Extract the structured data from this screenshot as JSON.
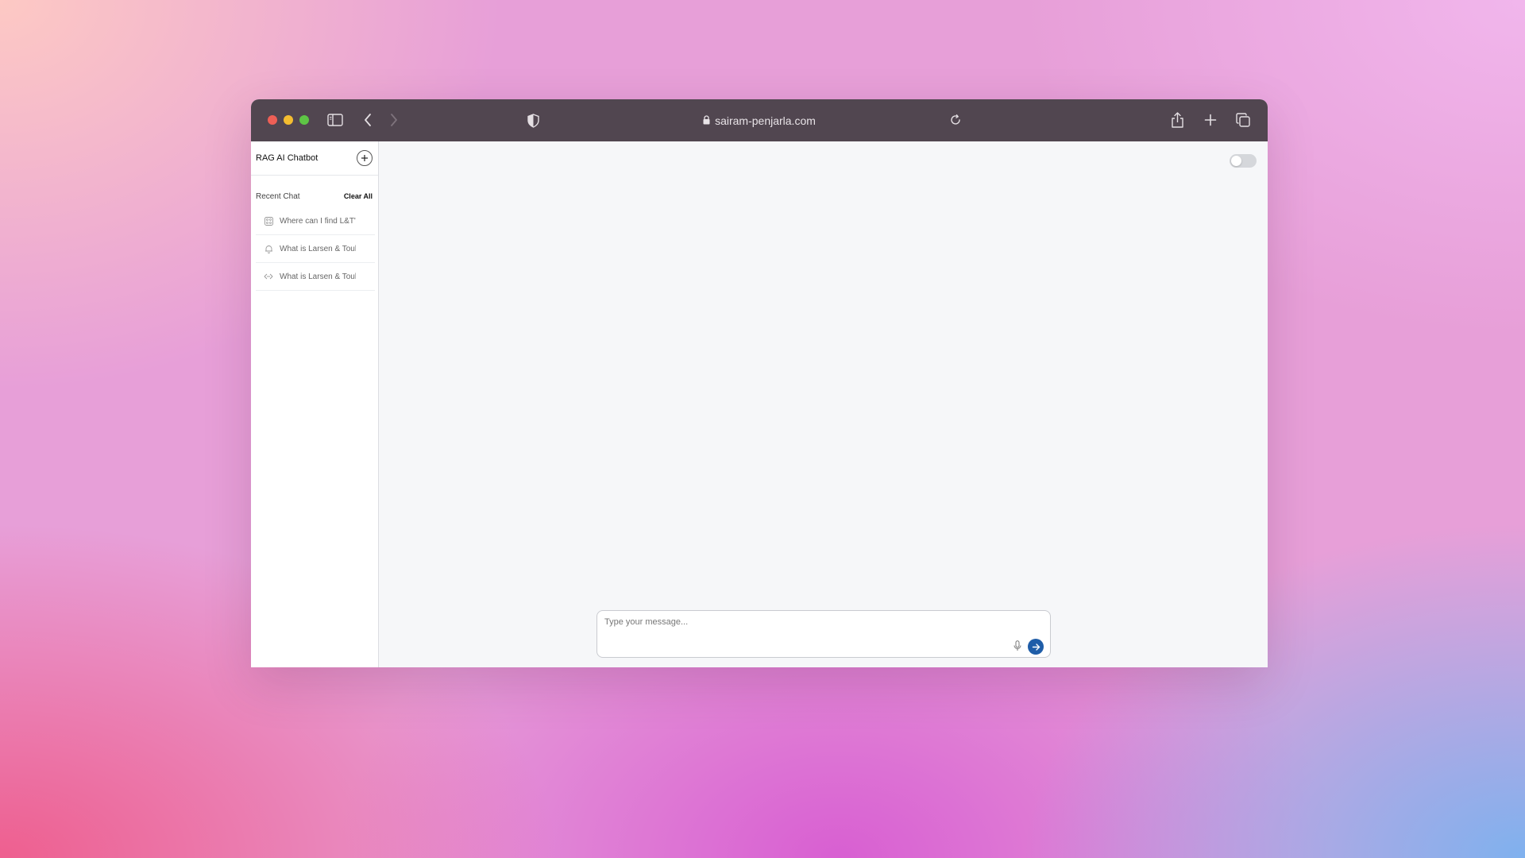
{
  "browser": {
    "url": "sairam-penjarla.com"
  },
  "sidebar": {
    "title": "RAG AI Chatbot",
    "recent_label": "Recent Chat",
    "clear_all_label": "Clear All",
    "chats": [
      {
        "label": "Where can I find L&T's",
        "icon": "chat-bubble-icon"
      },
      {
        "label": "What is Larsen & Toubro",
        "icon": "bell-icon"
      },
      {
        "label": "What is Larsen & Toubro",
        "icon": "code-icon"
      }
    ]
  },
  "main": {
    "input_placeholder": "Type your message...",
    "toggle_on": false
  },
  "colors": {
    "toolbar": "#514650",
    "send_button": "#1f5da8"
  }
}
